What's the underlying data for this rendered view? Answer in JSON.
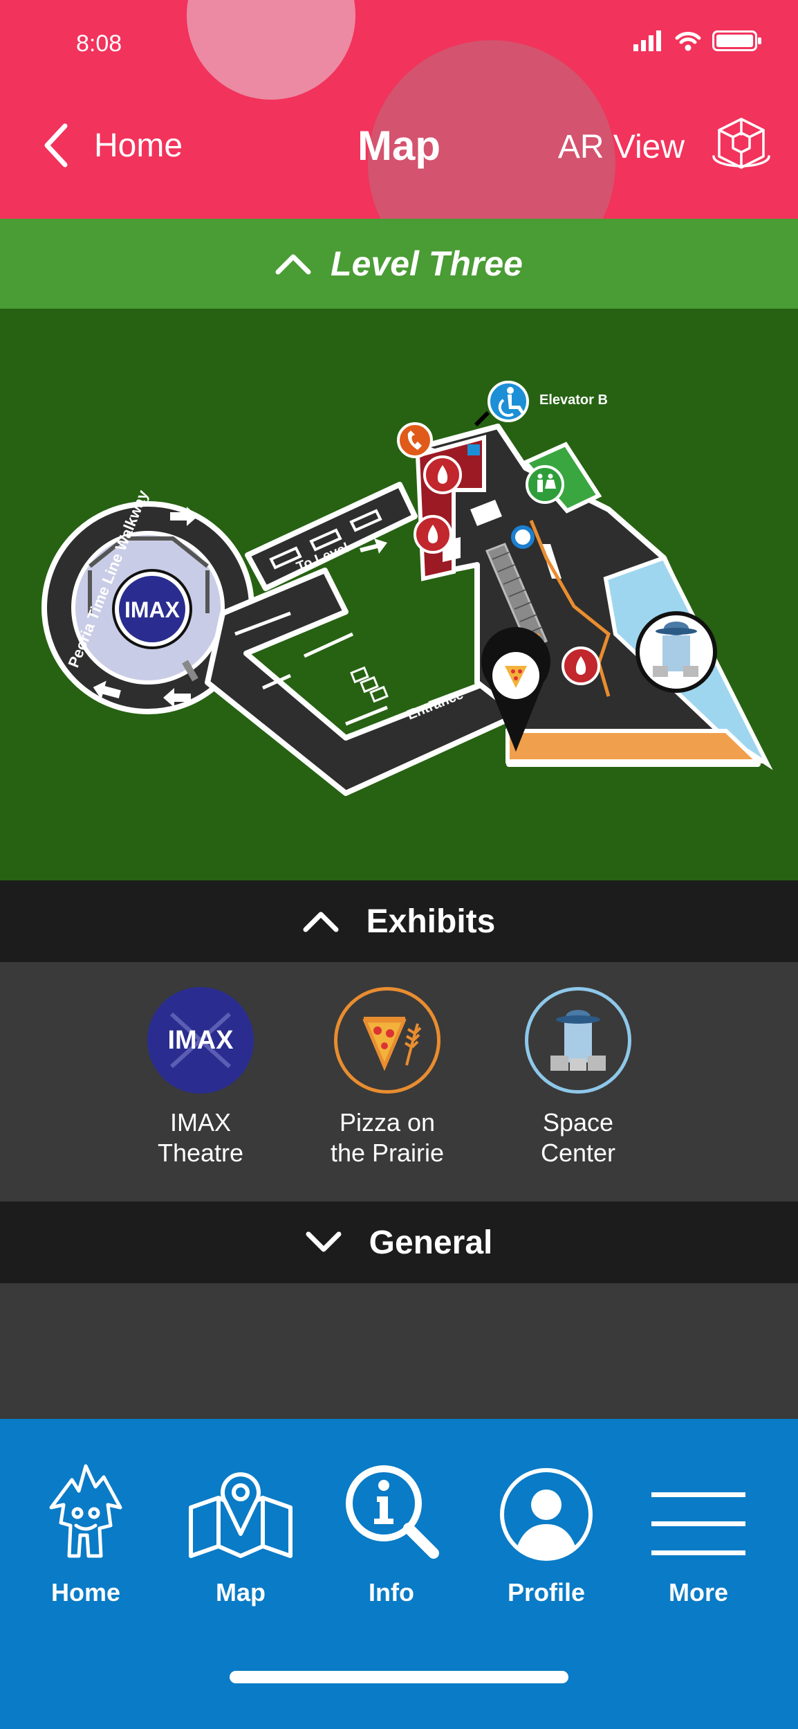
{
  "status_bar": {
    "time": "8:08"
  },
  "header": {
    "back_label": "Home",
    "title": "Map",
    "ar_label": "AR View"
  },
  "level": {
    "label": "Level Three"
  },
  "map": {
    "labels": {
      "elevator": "Elevator B",
      "walkway": "Peoria Time Line Walkway",
      "to_level": "To Level",
      "entrance": "Entrance",
      "imax": "IMAX"
    }
  },
  "exhibits": {
    "header": "Exhibits",
    "items": [
      {
        "line1": "IMAX",
        "line2": "Theatre",
        "icon": "imax-icon",
        "logo_text": "IMAX"
      },
      {
        "line1": "Pizza on",
        "line2": "the Prairie",
        "icon": "pizza-icon"
      },
      {
        "line1": "Space",
        "line2": "Center",
        "icon": "space-center-icon"
      }
    ]
  },
  "general": {
    "header": "General"
  },
  "tabbar": {
    "items": [
      {
        "label": "Home",
        "icon": "home-mascot-icon"
      },
      {
        "label": "Map",
        "icon": "map-pin-icon"
      },
      {
        "label": "Info",
        "icon": "info-search-icon"
      },
      {
        "label": "Profile",
        "icon": "profile-icon"
      },
      {
        "label": "More",
        "icon": "hamburger-menu-icon"
      }
    ]
  },
  "colors": {
    "header": "#f2335c",
    "level_bar": "#4a9c34",
    "map_bg": "#266212",
    "section_header": "#1c1c1c",
    "panel": "#3a3a3a",
    "tabbar": "#0a7bc6"
  }
}
